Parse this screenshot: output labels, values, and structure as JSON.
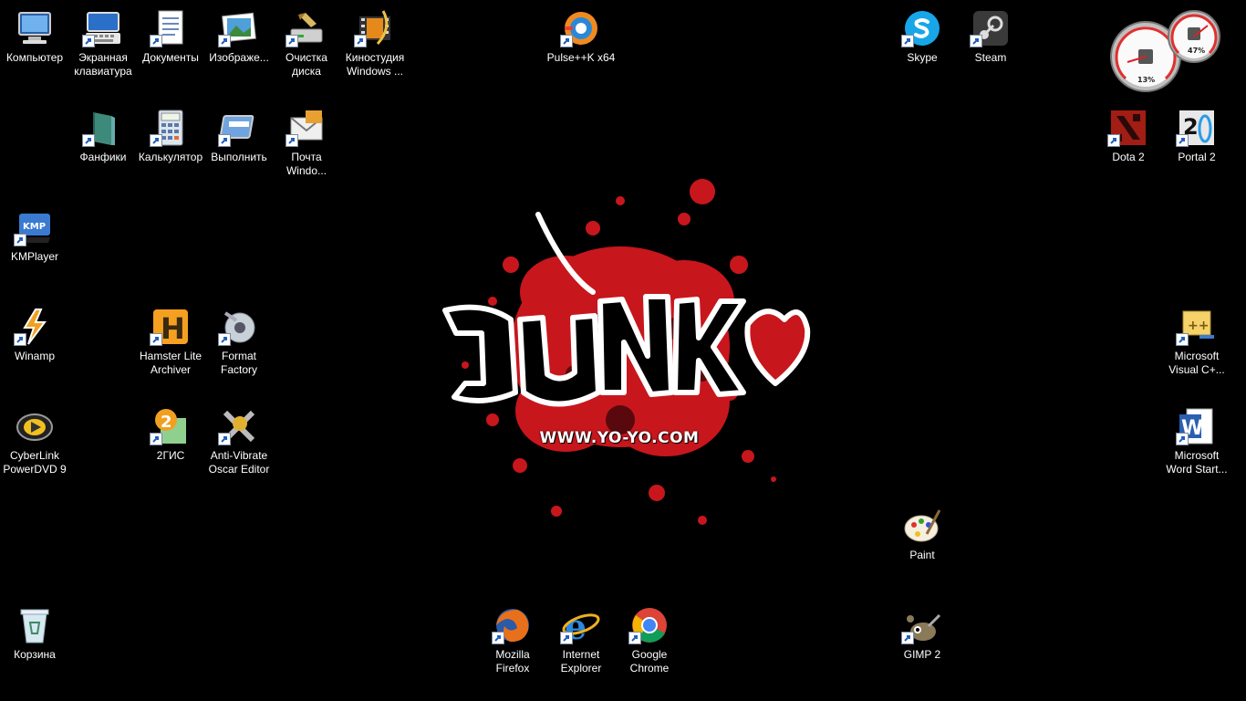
{
  "wallpaper": {
    "url_text": "WWW.YO-YO.COM"
  },
  "gadget": {
    "cpu_percent": "13%",
    "ram_percent": "47%",
    "cpu_value": 13,
    "ram_value": 47
  },
  "icons": [
    {
      "id": "computer",
      "label": "Компьютер",
      "icon": "computer-icon",
      "shortcut": false
    },
    {
      "id": "osk",
      "label": "Экранная клавиатура",
      "icon": "keyboard-icon",
      "shortcut": true
    },
    {
      "id": "documents",
      "label": "Документы",
      "icon": "documents-icon",
      "shortcut": true
    },
    {
      "id": "images",
      "label": "Изображе...",
      "icon": "images-icon",
      "shortcut": true
    },
    {
      "id": "cleanup",
      "label": "Очистка диска",
      "icon": "disk-cleanup-icon",
      "shortcut": true
    },
    {
      "id": "moviemaker",
      "label": "Киностудия Windows ...",
      "icon": "movie-maker-icon",
      "shortcut": true
    },
    {
      "id": "pulse",
      "label": "Pulse++K x64",
      "icon": "pulse-icon",
      "shortcut": true
    },
    {
      "id": "skype",
      "label": "Skype",
      "icon": "skype-icon",
      "shortcut": true
    },
    {
      "id": "steam",
      "label": "Steam",
      "icon": "steam-icon",
      "shortcut": true
    },
    {
      "id": "fanfiki",
      "label": "Фанфики",
      "icon": "folder-book-icon",
      "shortcut": true
    },
    {
      "id": "calc",
      "label": "Калькулятор",
      "icon": "calculator-icon",
      "shortcut": true
    },
    {
      "id": "run",
      "label": "Выполнить",
      "icon": "run-icon",
      "shortcut": true
    },
    {
      "id": "mail",
      "label": "Почта Windo...",
      "icon": "mail-icon",
      "shortcut": true
    },
    {
      "id": "dota",
      "label": "Dota 2",
      "icon": "dota-icon",
      "shortcut": true
    },
    {
      "id": "portal",
      "label": "Portal 2",
      "icon": "portal-icon",
      "shortcut": true
    },
    {
      "id": "kmplayer",
      "label": "KMPlayer",
      "icon": "kmplayer-icon",
      "shortcut": true
    },
    {
      "id": "winamp",
      "label": "Winamp",
      "icon": "winamp-icon",
      "shortcut": true
    },
    {
      "id": "hamster",
      "label": "Hamster Lite Archiver",
      "icon": "hamster-icon",
      "shortcut": true
    },
    {
      "id": "format",
      "label": "Format Factory",
      "icon": "format-factory-icon",
      "shortcut": true
    },
    {
      "id": "vcpp",
      "label": "Microsoft Visual C+...",
      "icon": "visual-cpp-icon",
      "shortcut": true
    },
    {
      "id": "powerdvd",
      "label": "CyberLink PowerDVD 9",
      "icon": "powerdvd-icon",
      "shortcut": false
    },
    {
      "id": "2gis",
      "label": "2ГИС",
      "icon": "2gis-icon",
      "shortcut": true
    },
    {
      "id": "antivibrate",
      "label": "Anti-Vibrate Oscar Editor",
      "icon": "oscar-icon",
      "shortcut": true
    },
    {
      "id": "word",
      "label": "Microsoft Word Start...",
      "icon": "word-icon",
      "shortcut": true
    },
    {
      "id": "paint",
      "label": "Paint",
      "icon": "paint-icon",
      "shortcut": false
    },
    {
      "id": "recycle",
      "label": "Корзина",
      "icon": "recycle-bin-icon",
      "shortcut": false
    },
    {
      "id": "firefox",
      "label": "Mozilla Firefox",
      "icon": "firefox-icon",
      "shortcut": true
    },
    {
      "id": "ie",
      "label": "Internet Explorer",
      "icon": "ie-icon",
      "shortcut": true
    },
    {
      "id": "chrome",
      "label": "Google Chrome",
      "icon": "chrome-icon",
      "shortcut": true
    },
    {
      "id": "gimp",
      "label": "GIMP 2",
      "icon": "gimp-icon",
      "shortcut": true
    }
  ]
}
